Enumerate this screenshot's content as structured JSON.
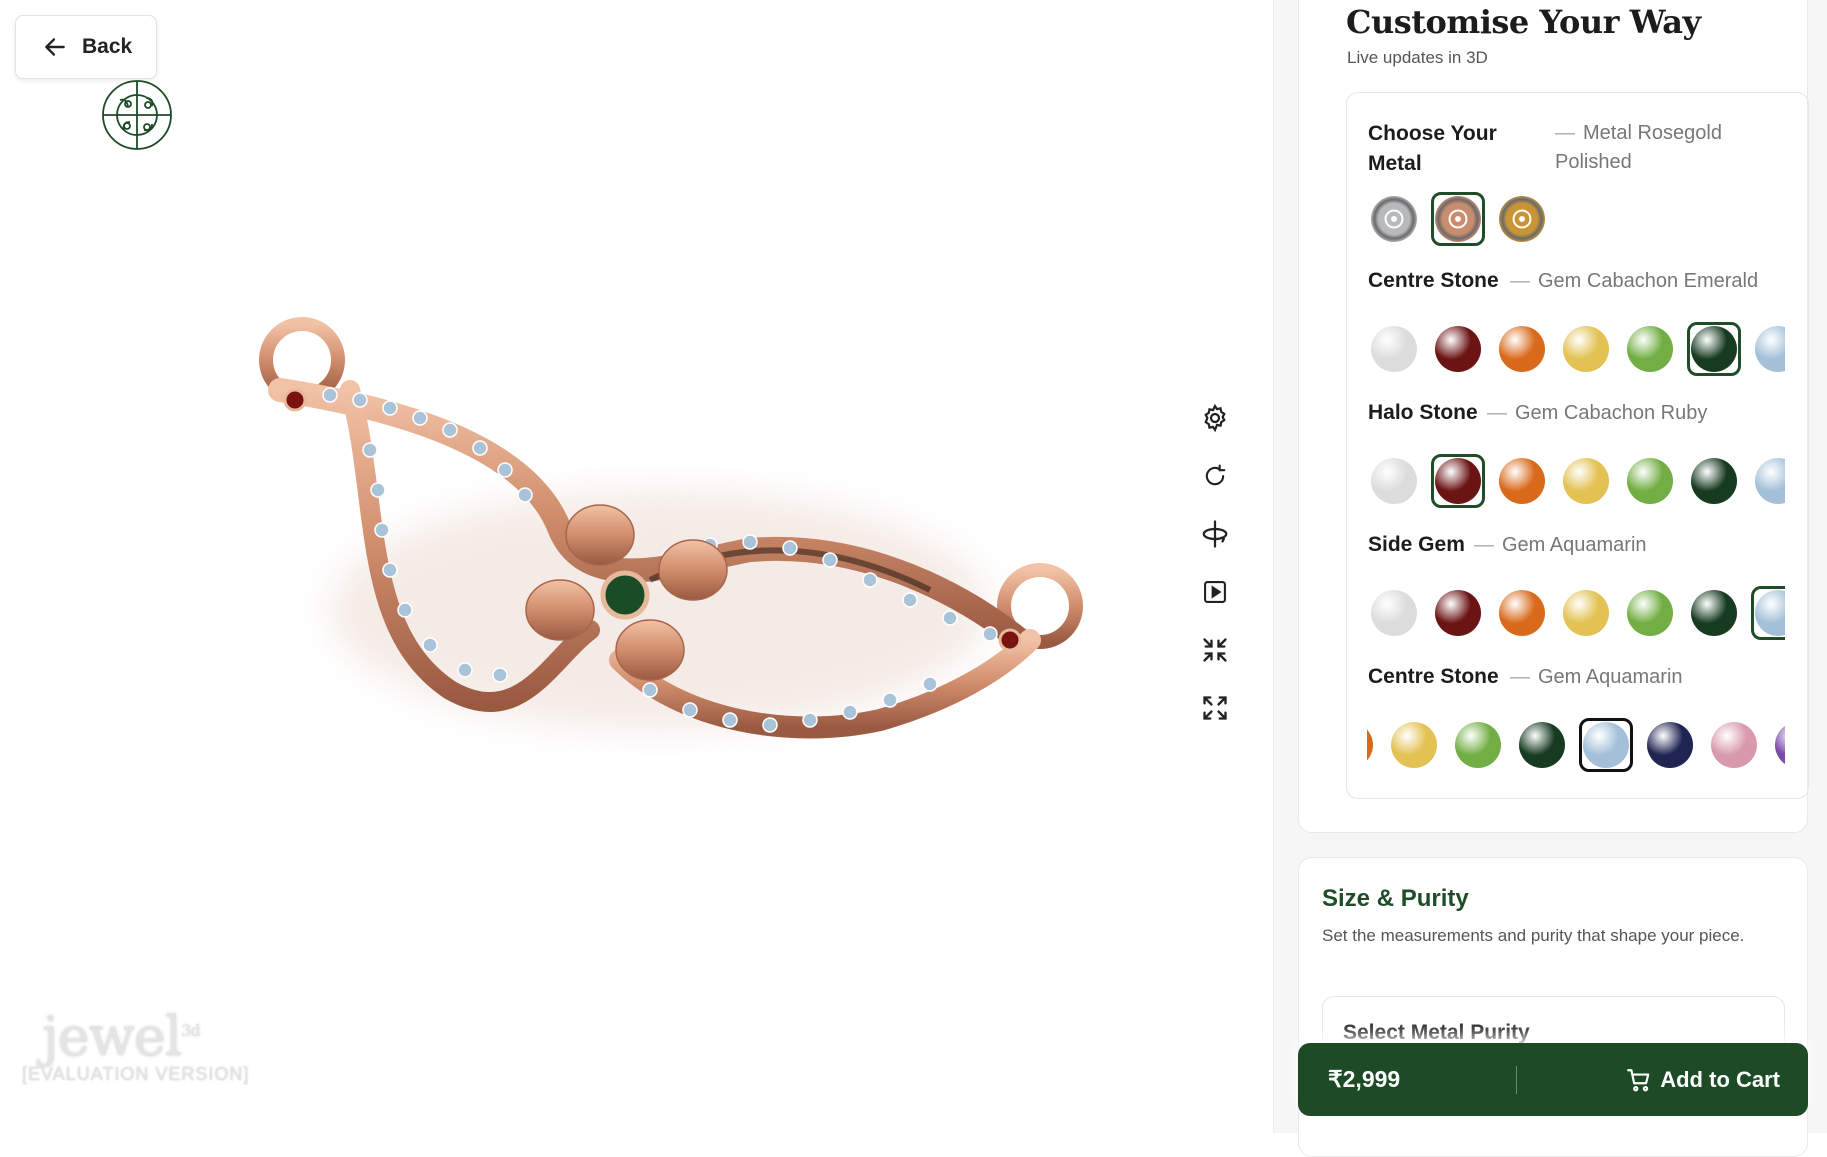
{
  "viewer": {
    "back_label": "Back",
    "watermark_main": "jewel",
    "watermark_sup": "3d",
    "watermark_sub": "[EVALUATION VERSION]",
    "tools": [
      "settings-icon",
      "rotate-icon",
      "spin-axis-icon",
      "play-icon",
      "collapse-icon",
      "expand-icon"
    ]
  },
  "customise": {
    "title": "Customise Your Way",
    "subtitle": "Live updates in 3D",
    "rows": [
      {
        "label": "Choose Your Metal",
        "value": "Metal Rosegold Polished"
      },
      {
        "label": "Centre Stone",
        "value": "Gem Cabachon Emerald"
      },
      {
        "label": "Halo Stone",
        "value": "Gem Cabachon Ruby"
      },
      {
        "label": "Side Gem",
        "value": "Gem Aquamarin"
      },
      {
        "label": "Centre Stone",
        "value": "Gem Aquamarin"
      }
    ],
    "metals": [
      "#b7b9bc",
      "#c98c6e",
      "#c99436"
    ],
    "gems": [
      "#dcdcdc",
      "#6b1414",
      "#d96a1c",
      "#e3c153",
      "#72ae44",
      "#173b21",
      "#a3c0d8",
      "#1f2452",
      "#d89aab",
      "#7a4aa8"
    ]
  },
  "size_purity": {
    "title": "Size & Purity",
    "description": "Set the measurements and purity that shape your piece.",
    "purity_title": "Select Metal Purity"
  },
  "cart": {
    "price": "₹2,999",
    "button_label": "Add to Cart"
  },
  "colors": {
    "brand_green": "#1c4b26",
    "rose_gold": "#d99a7a"
  }
}
